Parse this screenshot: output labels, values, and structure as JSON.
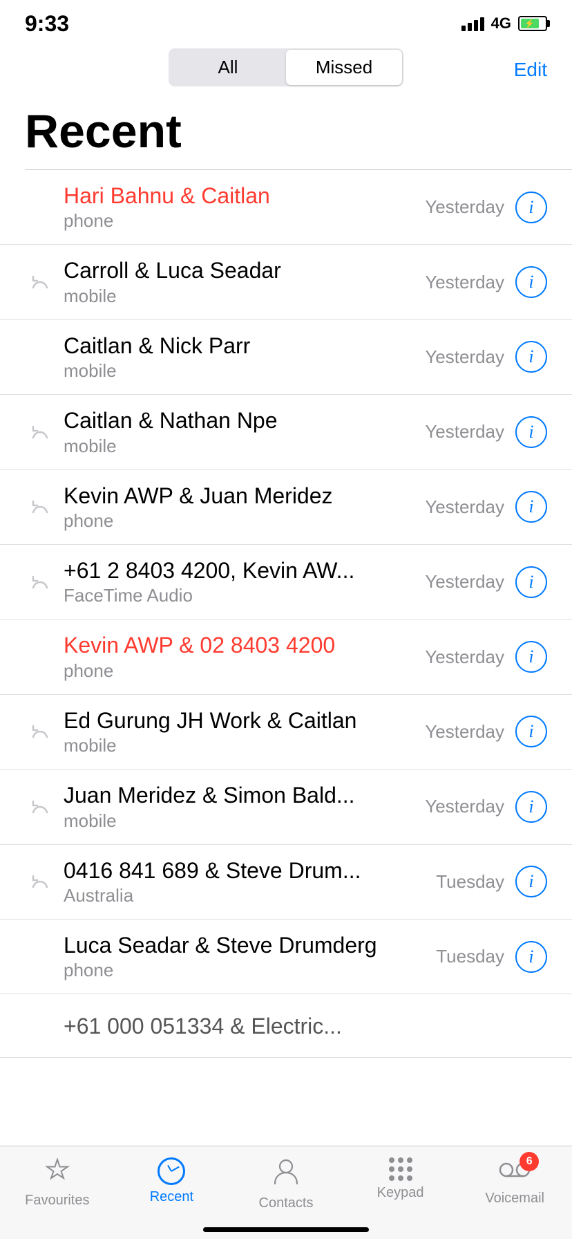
{
  "statusBar": {
    "time": "9:33",
    "signal": "4G",
    "battery": "75"
  },
  "segmentControl": {
    "options": [
      "All",
      "Missed"
    ],
    "active": "Missed"
  },
  "editButton": "Edit",
  "pageTitle": "Recent",
  "calls": [
    {
      "name": "Hari Bahnu & Caitlan",
      "type": "phone",
      "time": "Yesterday",
      "missed": true,
      "missedIcon": true
    },
    {
      "name": "Carroll & Luca Seadar",
      "type": "mobile",
      "time": "Yesterday",
      "missed": false,
      "missedIcon": true
    },
    {
      "name": "Caitlan & Nick Parr",
      "type": "mobile",
      "time": "Yesterday",
      "missed": false,
      "missedIcon": false
    },
    {
      "name": "Caitlan & Nathan Npe",
      "type": "mobile",
      "time": "Yesterday",
      "missed": false,
      "missedIcon": true
    },
    {
      "name": "Kevin AWP & Juan Meridez",
      "type": "phone",
      "time": "Yesterday",
      "missed": false,
      "missedIcon": true
    },
    {
      "name": "+61 2 8403 4200, Kevin AW...",
      "type": "FaceTime Audio",
      "time": "Yesterday",
      "missed": false,
      "missedIcon": true
    },
    {
      "name": "Kevin AWP & 02 8403 4200",
      "type": "phone",
      "time": "Yesterday",
      "missed": true,
      "missedIcon": false
    },
    {
      "name": "Ed Gurung JH Work & Caitlan",
      "type": "mobile",
      "time": "Yesterday",
      "missed": false,
      "missedIcon": true
    },
    {
      "name": "Juan Meridez & Simon Bald...",
      "type": "mobile",
      "time": "Yesterday",
      "missed": false,
      "missedIcon": true
    },
    {
      "name": "0416 841 689 & Steve Drum...",
      "type": "Australia",
      "time": "Tuesday",
      "missed": false,
      "missedIcon": true
    },
    {
      "name": "Luca Seadar & Steve Drumderg",
      "type": "phone",
      "time": "Tuesday",
      "missed": false,
      "missedIcon": false
    },
    {
      "name": "+61 000 051334 & Electric...",
      "type": "",
      "time": "",
      "missed": false,
      "missedIcon": false
    }
  ],
  "bottomNav": {
    "items": [
      {
        "label": "Favourites",
        "icon": "star",
        "active": false
      },
      {
        "label": "Recent",
        "icon": "clock",
        "active": true
      },
      {
        "label": "Contacts",
        "icon": "person",
        "active": false
      },
      {
        "label": "Keypad",
        "icon": "keypad",
        "active": false
      },
      {
        "label": "Voicemail",
        "icon": "voicemail",
        "active": false,
        "badge": "6"
      }
    ]
  }
}
